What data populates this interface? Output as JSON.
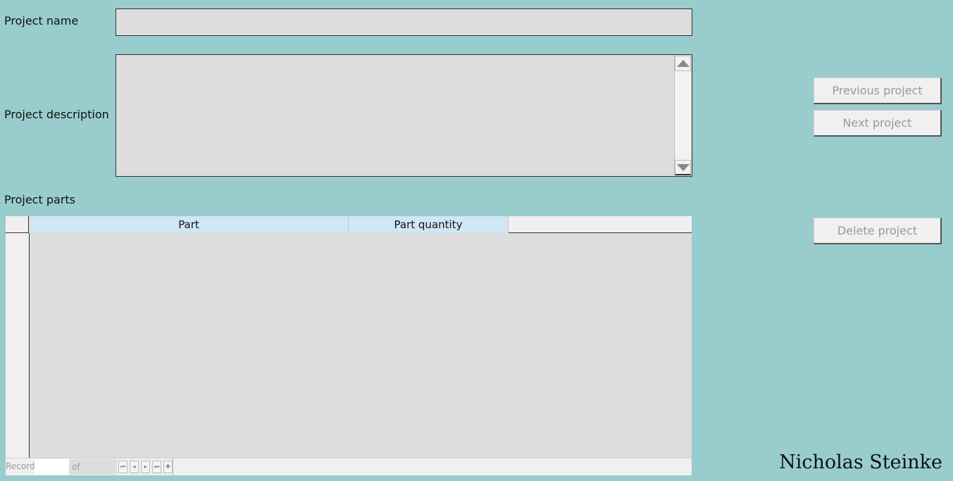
{
  "form": {
    "project_name_label": "Project name",
    "project_name_value": "",
    "project_description_label": "Project description",
    "project_description_value": "",
    "project_parts_label": "Project parts"
  },
  "buttons": {
    "previous": "Previous project",
    "next": "Next project",
    "delete": "Delete project"
  },
  "grid": {
    "columns": [
      "Part",
      "Part quantity"
    ],
    "rows": []
  },
  "navigator": {
    "record_label": "Record",
    "record_value": "",
    "of_label": "of",
    "buttons": [
      "first-record",
      "previous-record",
      "next-record",
      "last-record",
      "new-record"
    ]
  },
  "signature": "Nicholas Steinke"
}
